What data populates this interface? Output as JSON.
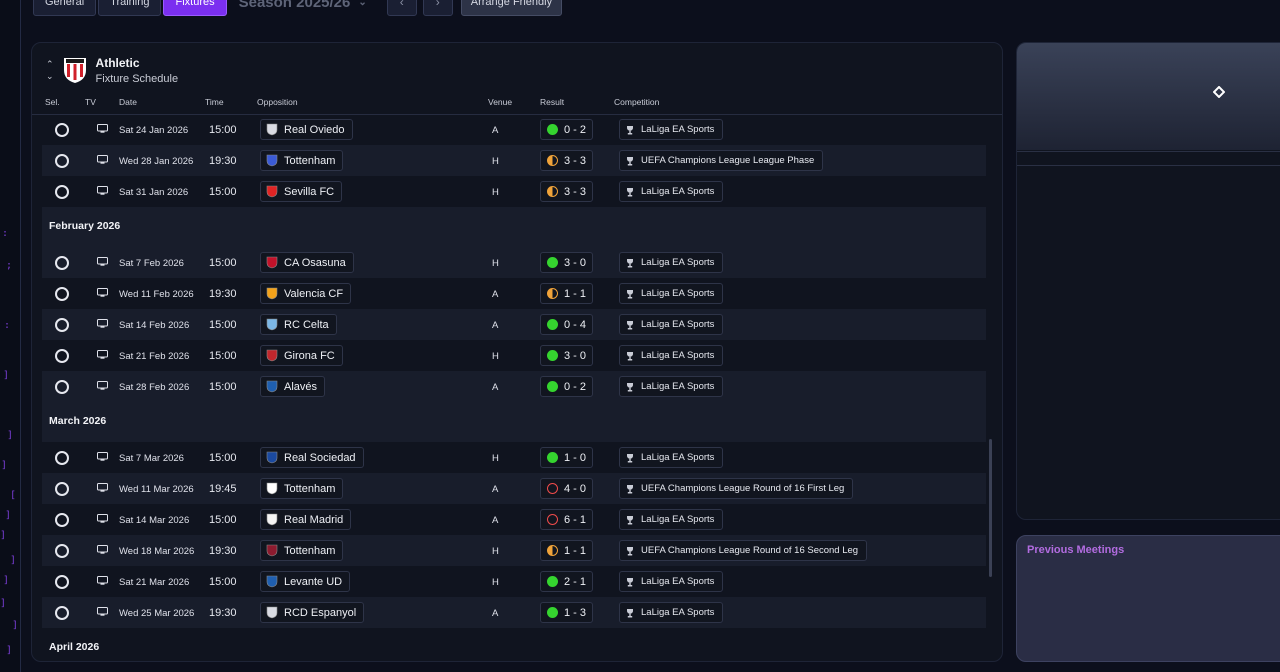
{
  "tabs": [
    {
      "label": "General",
      "active": false
    },
    {
      "label": "Training",
      "active": false
    },
    {
      "label": "Fixtures",
      "active": true
    }
  ],
  "season": {
    "label": "Season 2025/26"
  },
  "arrange_friendly": "Arrange Friendly",
  "club": {
    "name": "Athletic",
    "subtitle": "Fixture Schedule"
  },
  "columns": {
    "sel": "Sel.",
    "tv": "TV",
    "date": "Date",
    "time": "Time",
    "opposition": "Opposition",
    "venue": "Venue",
    "result": "Result",
    "competition": "Competition"
  },
  "fixtures": [
    {
      "type": "row",
      "date": "Sat 24 Jan 2026",
      "time": "15:00",
      "opp": "Real Oviedo",
      "venue": "A",
      "result": "0 - 2",
      "outcome": "win",
      "comp": "LaLiga EA Sports",
      "stripe": false
    },
    {
      "type": "row",
      "date": "Wed 28 Jan 2026",
      "time": "19:30",
      "opp": "Tottenham",
      "venue": "H",
      "result": "3 - 3",
      "outcome": "draw",
      "comp": "UEFA Champions League League Phase",
      "stripe": true
    },
    {
      "type": "row",
      "date": "Sat 31 Jan 2026",
      "time": "15:00",
      "opp": "Sevilla FC",
      "venue": "H",
      "result": "3 - 3",
      "outcome": "draw",
      "comp": "LaLiga EA Sports",
      "stripe": false
    },
    {
      "type": "month",
      "label": "February 2026"
    },
    {
      "type": "row",
      "date": "Sat 7 Feb 2026",
      "time": "15:00",
      "opp": "CA Osasuna",
      "venue": "H",
      "result": "3 - 0",
      "outcome": "win",
      "comp": "LaLiga EA Sports",
      "stripe": true
    },
    {
      "type": "row",
      "date": "Wed 11 Feb 2026",
      "time": "19:30",
      "opp": "Valencia CF",
      "venue": "A",
      "result": "1 - 1",
      "outcome": "draw",
      "comp": "LaLiga EA Sports",
      "stripe": false
    },
    {
      "type": "row",
      "date": "Sat 14 Feb 2026",
      "time": "15:00",
      "opp": "RC Celta",
      "venue": "A",
      "result": "0 - 4",
      "outcome": "win",
      "comp": "LaLiga EA Sports",
      "stripe": true
    },
    {
      "type": "row",
      "date": "Sat 21 Feb 2026",
      "time": "15:00",
      "opp": "Girona FC",
      "venue": "H",
      "result": "3 - 0",
      "outcome": "win",
      "comp": "LaLiga EA Sports",
      "stripe": false
    },
    {
      "type": "row",
      "date": "Sat 28 Feb 2026",
      "time": "15:00",
      "opp": "Alavés",
      "venue": "A",
      "result": "0 - 2",
      "outcome": "win",
      "comp": "LaLiga EA Sports",
      "stripe": true
    },
    {
      "type": "month",
      "label": "March 2026"
    },
    {
      "type": "row",
      "date": "Sat 7 Mar 2026",
      "time": "15:00",
      "opp": "Real Sociedad",
      "venue": "H",
      "result": "1 - 0",
      "outcome": "win",
      "comp": "LaLiga EA Sports",
      "stripe": false
    },
    {
      "type": "row",
      "date": "Wed 11 Mar 2026",
      "time": "19:45",
      "opp": "Tottenham",
      "venue": "A",
      "result": "4 - 0",
      "outcome": "loss",
      "comp": "UEFA Champions League Round of 16 First Leg",
      "stripe": true
    },
    {
      "type": "row",
      "date": "Sat 14 Mar 2026",
      "time": "15:00",
      "opp": "Real Madrid",
      "venue": "A",
      "result": "6 - 1",
      "outcome": "loss",
      "comp": "LaLiga EA Sports",
      "stripe": false
    },
    {
      "type": "row",
      "date": "Wed 18 Mar 2026",
      "time": "19:30",
      "opp": "Tottenham",
      "venue": "H",
      "result": "1 - 1",
      "outcome": "draw",
      "comp": "UEFA Champions League Round of 16 Second Leg",
      "stripe": true
    },
    {
      "type": "row",
      "date": "Sat 21 Mar 2026",
      "time": "15:00",
      "opp": "Levante UD",
      "venue": "H",
      "result": "2 - 1",
      "outcome": "win",
      "comp": "LaLiga EA Sports",
      "stripe": false
    },
    {
      "type": "row",
      "date": "Wed 25 Mar 2026",
      "time": "19:30",
      "opp": "RCD Espanyol",
      "venue": "A",
      "result": "1 - 3",
      "outcome": "win",
      "comp": "LaLiga EA Sports",
      "stripe": true
    },
    {
      "type": "month",
      "label": "April 2026"
    }
  ],
  "previous_meetings": {
    "title": "Previous Meetings"
  },
  "colors": {
    "accent": "#7b2ff0",
    "win": "#35d42f",
    "draw": "#f0a33a",
    "loss": "#ef4b4b",
    "prev_title": "#b26ce0"
  }
}
